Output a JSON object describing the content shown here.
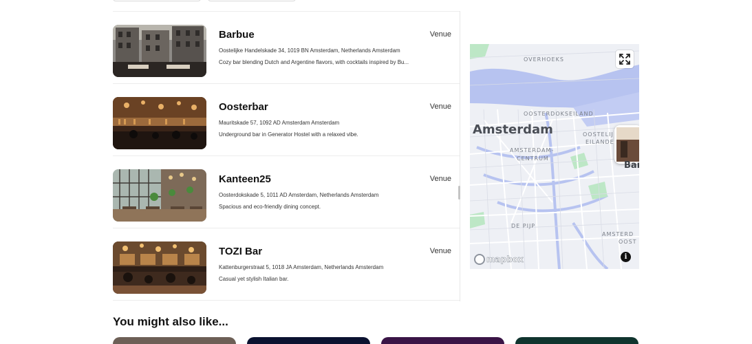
{
  "venues": [
    {
      "name": "Barbue",
      "type": "Venue",
      "address": "Oostelijke Handelskade 34, 1019 BN Amsterdam, Netherlands Amsterdam",
      "description": "Cozy bar blending Dutch and Argentine flavors, with cocktails inspired by Bu..."
    },
    {
      "name": "Oosterbar",
      "type": "Venue",
      "address": "Mauritskade 57, 1092 AD Amsterdam Amsterdam",
      "description": "Underground bar in Generator Hostel with a relaxed vibe."
    },
    {
      "name": "Kanteen25",
      "type": "Venue",
      "address": "Oosterdokskade 5, 1011 AD Amsterdam, Netherlands Amsterdam",
      "description": "Spacious and eco-friendly dining concept."
    },
    {
      "name": "TOZI Bar",
      "type": "Venue",
      "address": "Kattenburgerstraat 5, 1018 JA Amsterdam, Netherlands Amsterdam",
      "description": "Casual yet stylish Italian bar."
    }
  ],
  "map": {
    "city_label": "Amsterdam",
    "labels": {
      "overhoeks": "OVERHOEKS",
      "oosterdokseiland": "OOSTERDOKSEILAND",
      "oostelijk_line1": "OOSTELIJ",
      "oostelijk_line2": "EILANDE",
      "centrum_line1": "AMSTERDAM-",
      "centrum_line2": "CENTRUM",
      "depijp": "DE PIJP",
      "oost_line1": "AMSTERD",
      "oost_line2": "OOST"
    },
    "pin_label": "Bar",
    "attribution": "mapbox",
    "info_glyph": "i",
    "icons": {
      "fullscreen": "fullscreen-icon",
      "info": "info-icon",
      "logo": "mapbox-logo-icon"
    },
    "colors": {
      "water": "#b7c3f0",
      "park": "#bde7c6",
      "land": "#eef0f5",
      "roads": "#ffffff"
    }
  },
  "recommendations": {
    "title": "You might also like...",
    "card_colors": [
      "#6d5f56",
      "#0b1230",
      "#3a1446",
      "#10342e"
    ]
  }
}
